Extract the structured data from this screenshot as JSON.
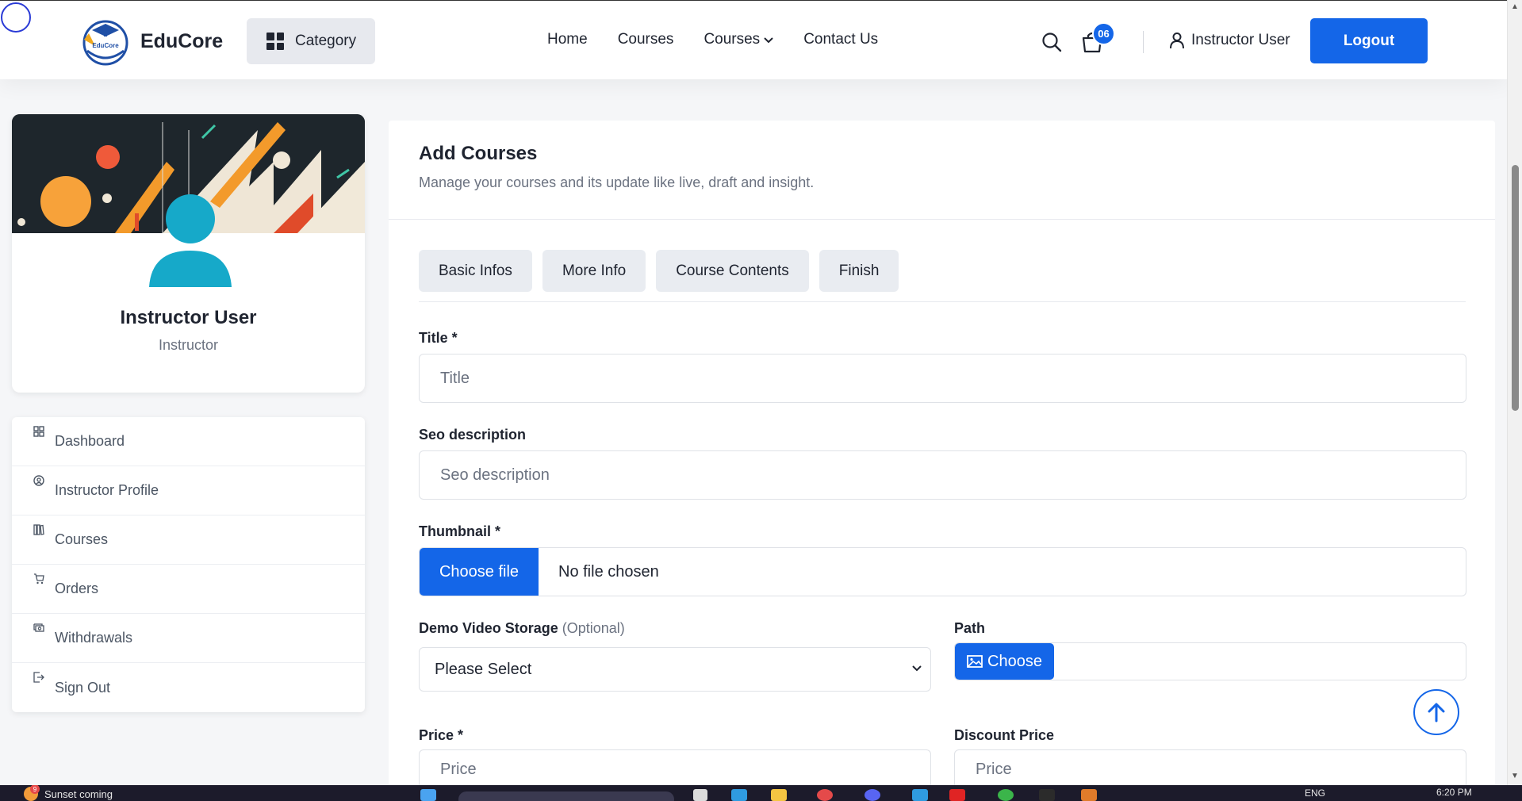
{
  "brand": {
    "name": "EduCore",
    "logo_text": "EduCore"
  },
  "header": {
    "category_label": "Category",
    "nav": [
      {
        "label": "Home"
      },
      {
        "label": "Courses"
      },
      {
        "label": "Courses",
        "has_dropdown": true
      },
      {
        "label": "Contact Us"
      }
    ],
    "cart_count": "06",
    "user_label": "Instructor User",
    "logout_label": "Logout"
  },
  "sidebar": {
    "profile": {
      "name": "Instructor User",
      "role": "Instructor"
    },
    "items": [
      {
        "label": "Dashboard",
        "icon": "dashboard-icon"
      },
      {
        "label": "Instructor Profile",
        "icon": "user-circle-icon"
      },
      {
        "label": "Courses",
        "icon": "books-icon"
      },
      {
        "label": "Orders",
        "icon": "cart-icon"
      },
      {
        "label": "Withdrawals",
        "icon": "cash-icon"
      },
      {
        "label": "Sign Out",
        "icon": "sign-out-icon"
      }
    ]
  },
  "main": {
    "title": "Add Courses",
    "subtitle": "Manage your courses and its update like live, draft and insight.",
    "tabs": [
      {
        "label": "Basic Infos"
      },
      {
        "label": "More Info"
      },
      {
        "label": "Course Contents"
      },
      {
        "label": "Finish"
      }
    ],
    "form": {
      "title_label": "Title *",
      "title_placeholder": "Title",
      "seo_label": "Seo description",
      "seo_placeholder": "Seo description",
      "thumbnail_label": "Thumbnail *",
      "thumbnail_button": "Choose file",
      "thumbnail_status": "No file chosen",
      "demo_label": "Demo Video Storage",
      "demo_optional": "(Optional)",
      "demo_selected": "Please Select",
      "path_label": "Path",
      "path_button": "Choose",
      "price_label": "Price *",
      "price_placeholder": "Price",
      "discount_label": "Discount Price",
      "discount_placeholder": "Price"
    }
  },
  "taskbar": {
    "weather_text": "Sunset coming",
    "weather_badge": "9",
    "language": "ENG",
    "time": "6:20 PM"
  },
  "colors": {
    "primary": "#1466e8",
    "avatar": "#16a9c9",
    "text_dark": "#1f2430",
    "text_muted": "#6b7280"
  }
}
